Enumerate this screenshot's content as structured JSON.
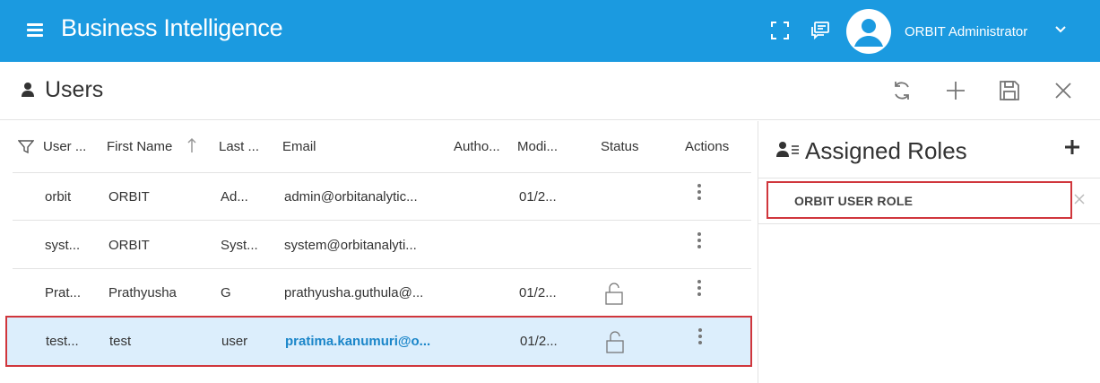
{
  "app": {
    "title": "Business Intelligence",
    "user_name": "ORBIT Administrator"
  },
  "page": {
    "title": "Users"
  },
  "grid": {
    "columns": [
      "User ...",
      "First Name",
      "Last ...",
      "Email",
      "Autho...",
      "Modi...",
      "Status",
      "Actions"
    ],
    "rows": [
      {
        "user": "orbit",
        "first": "ORBIT",
        "last": "Ad...",
        "email": "admin@orbitanalytic...",
        "modified": "01/2...",
        "locked": false
      },
      {
        "user": "syst...",
        "first": "ORBIT",
        "last": "Syst...",
        "email": "system@orbitanalyti...",
        "modified": "",
        "locked": false
      },
      {
        "user": "Prat...",
        "first": "Prathyusha",
        "last": "G",
        "email": "prathyusha.guthula@...",
        "modified": "01/2...",
        "locked": true
      },
      {
        "user": "test...",
        "first": "test",
        "last": "user",
        "email": "pratima.kanumuri@o...",
        "modified": "01/2...",
        "locked": true,
        "selected": true
      }
    ]
  },
  "roles": {
    "title": "Assigned Roles",
    "items": [
      "ORBIT USER ROLE"
    ]
  },
  "colors": {
    "accent": "#1b9ae0",
    "selected_row": "#dceefc",
    "highlight_border": "#d0363c",
    "link": "#1b86c9"
  }
}
